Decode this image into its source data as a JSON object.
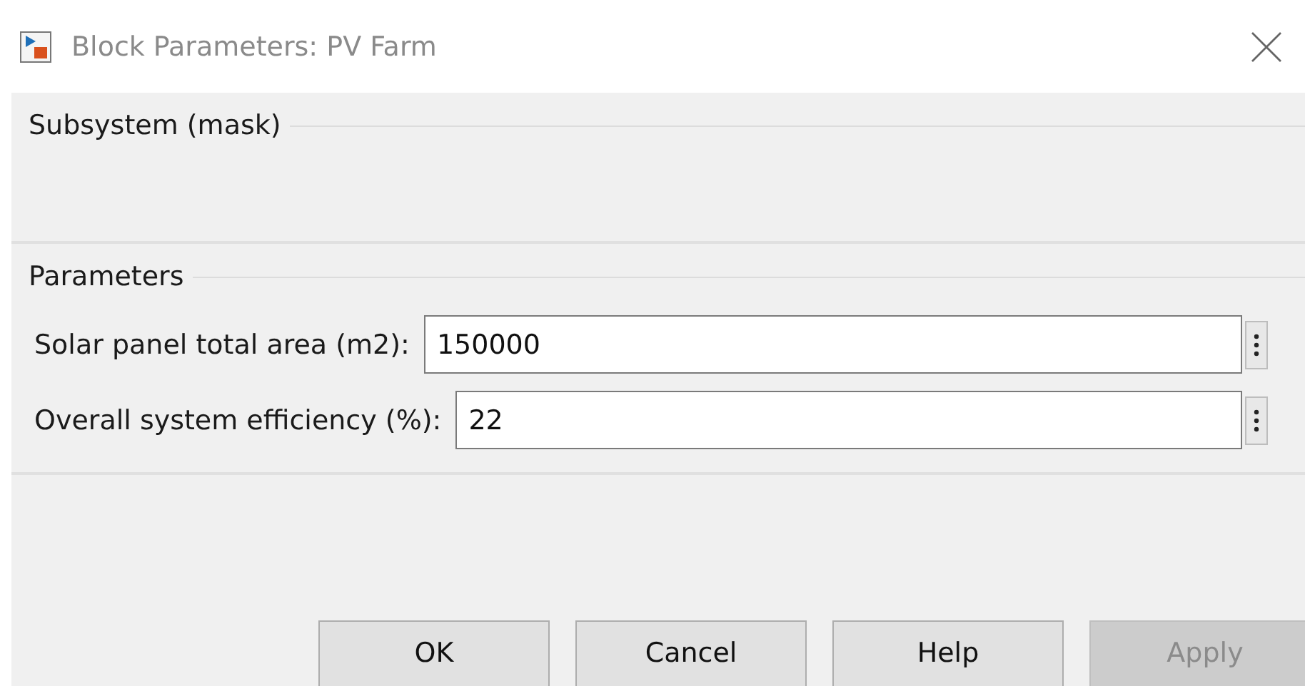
{
  "window": {
    "title": "Block Parameters: PV Farm"
  },
  "description_group": {
    "legend": "Subsystem (mask)"
  },
  "parameters_group": {
    "legend": "Parameters",
    "fields": [
      {
        "label": "Solar panel total area (m2):",
        "value": "150000"
      },
      {
        "label": "Overall system efficiency (%):",
        "value": "22"
      }
    ]
  },
  "buttons": [
    {
      "label": "OK",
      "disabled": false
    },
    {
      "label": "Cancel",
      "disabled": false
    },
    {
      "label": "Help",
      "disabled": false
    },
    {
      "label": "Apply",
      "disabled": true
    }
  ]
}
